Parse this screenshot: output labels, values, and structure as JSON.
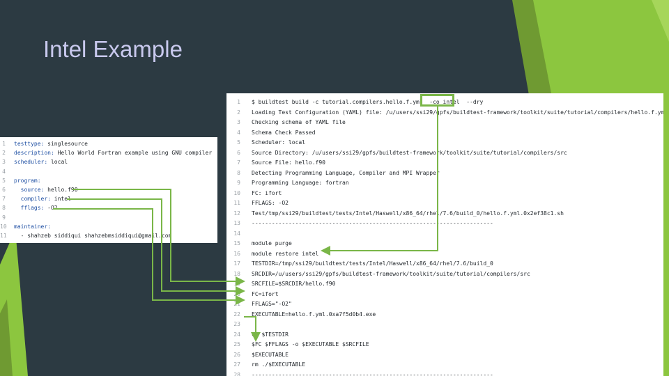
{
  "title": "Intel Example",
  "colors": {
    "background": "#2c3a42",
    "accent": "#7ab648",
    "title": "#c9c9ee"
  },
  "yaml": {
    "lines": [
      {
        "n": "1",
        "key": "testtype:",
        "val": " singlesource"
      },
      {
        "n": "2",
        "key": "description:",
        "val": " Hello World Fortran example using GNU compiler"
      },
      {
        "n": "3",
        "key": "scheduler:",
        "val": " local"
      },
      {
        "n": "4",
        "key": "",
        "val": ""
      },
      {
        "n": "5",
        "key": "program:",
        "val": ""
      },
      {
        "n": "6",
        "key": "  source:",
        "val": " hello.f90"
      },
      {
        "n": "7",
        "key": "  compiler:",
        "val": " intel"
      },
      {
        "n": "8",
        "key": "  fflags:",
        "val": " -O2"
      },
      {
        "n": "9",
        "key": "",
        "val": ""
      },
      {
        "n": "10",
        "key": "maintainer:",
        "val": ""
      },
      {
        "n": "11",
        "key": "",
        "val": "  - shahzeb siddiqui shahzebmsiddiqui@gmail.com"
      }
    ]
  },
  "terminal": {
    "lines": [
      {
        "n": "1",
        "t": "$ buildtest build -c tutorial.compilers.hello.f.yml  -co intel  --dry"
      },
      {
        "n": "2",
        "t": "Loading Test Configuration (YAML) file: /u/users/ssi29/gpfs/buildtest-framework/toolkit/suite/tutorial/compilers/hello.f.yml"
      },
      {
        "n": "3",
        "t": "Checking schema of YAML file"
      },
      {
        "n": "4",
        "t": "Schema Check Passed"
      },
      {
        "n": "5",
        "t": "Scheduler: local"
      },
      {
        "n": "6",
        "t": "Source Directory: /u/users/ssi29/gpfs/buildtest-framework/toolkit/suite/tutorial/compilers/src"
      },
      {
        "n": "7",
        "t": "Source File: hello.f90"
      },
      {
        "n": "8",
        "t": "Detecting Programming Language, Compiler and MPI Wrapper"
      },
      {
        "n": "9",
        "t": "Programming Language: fortran"
      },
      {
        "n": "10",
        "t": "FC: ifort"
      },
      {
        "n": "11",
        "t": "FFLAGS: -O2"
      },
      {
        "n": "12",
        "t": "Test/tmp/ssi29/buildtest/tests/Intel/Haswell/x86_64/rhel/7.6/build_0/hello.f.yml.0x2ef38c1.sh"
      },
      {
        "n": "13",
        "t": "------------------------------------------------------------------------"
      },
      {
        "n": "14",
        "t": ""
      },
      {
        "n": "15",
        "t": "module purge"
      },
      {
        "n": "16",
        "t": "module restore intel"
      },
      {
        "n": "17",
        "t": "TESTDIR=/tmp/ssi29/buildtest/tests/Intel/Haswell/x86_64/rhel/7.6/build_0"
      },
      {
        "n": "18",
        "t": "SRCDIR=/u/users/ssi29/gpfs/buildtest-framework/toolkit/suite/tutorial/compilers/src"
      },
      {
        "n": "19",
        "t": "SRCFILE=$SRCDIR/hello.f90"
      },
      {
        "n": "20",
        "t": "FC=ifort"
      },
      {
        "n": "21",
        "t": "FFLAGS=\"-O2\""
      },
      {
        "n": "22",
        "t": "EXECUTABLE=hello.f.yml.0xa7f5d0b4.exe"
      },
      {
        "n": "23",
        "t": ""
      },
      {
        "n": "24",
        "t": "cd $TESTDIR"
      },
      {
        "n": "25",
        "t": "$FC $FFLAGS -o $EXECUTABLE $SRCFILE"
      },
      {
        "n": "26",
        "t": "$EXECUTABLE"
      },
      {
        "n": "27",
        "t": "rm ./$EXECUTABLE"
      },
      {
        "n": "28",
        "t": "------------------------------------------------------------------------"
      }
    ]
  }
}
